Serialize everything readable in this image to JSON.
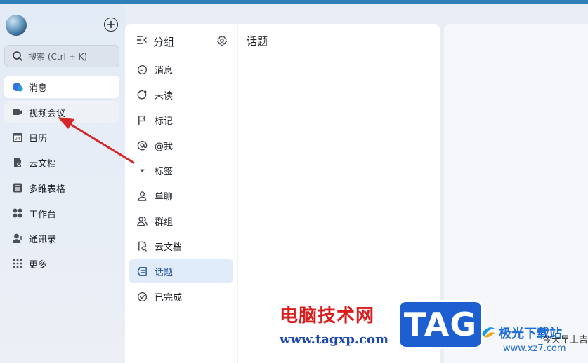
{
  "sidebar": {
    "search_label": "搜索 (Ctrl + K)",
    "items": [
      {
        "label": "消息",
        "icon": "message-icon"
      },
      {
        "label": "视频会议",
        "icon": "video-icon"
      },
      {
        "label": "日历",
        "icon": "calendar-icon"
      },
      {
        "label": "云文档",
        "icon": "cloud-doc-icon"
      },
      {
        "label": "多维表格",
        "icon": "table-icon"
      },
      {
        "label": "工作台",
        "icon": "workbench-icon"
      },
      {
        "label": "通讯录",
        "icon": "contacts-icon"
      },
      {
        "label": "更多",
        "icon": "more-icon"
      }
    ],
    "calendar_day": "24"
  },
  "groups": {
    "title": "分组",
    "items": [
      {
        "label": "消息",
        "icon": "chat-bubble-icon"
      },
      {
        "label": "未读",
        "icon": "unread-icon"
      },
      {
        "label": "标记",
        "icon": "flag-icon"
      },
      {
        "label": "@我",
        "icon": "at-icon"
      },
      {
        "label": "标签",
        "icon": "triangle-down-icon"
      },
      {
        "label": "单聊",
        "icon": "person-icon"
      },
      {
        "label": "群组",
        "icon": "group-icon"
      },
      {
        "label": "云文档",
        "icon": "doc-search-icon"
      },
      {
        "label": "话题",
        "icon": "topic-icon"
      },
      {
        "label": "已完成",
        "icon": "check-circle-icon"
      }
    ]
  },
  "topics": {
    "title": "话题"
  },
  "colors": {
    "accent": "#1f4f9a",
    "active_bg": "#e1ecfb",
    "arrow": "#d42828",
    "topbar": "#2f7fb8"
  },
  "watermark": {
    "cn": "电脑技术网",
    "url": "www.tagxp.com",
    "tag": "TAG",
    "xz_cn": "极光下载站",
    "xz_url": "www.xz7.com",
    "cut_text": "今天早上吉"
  }
}
